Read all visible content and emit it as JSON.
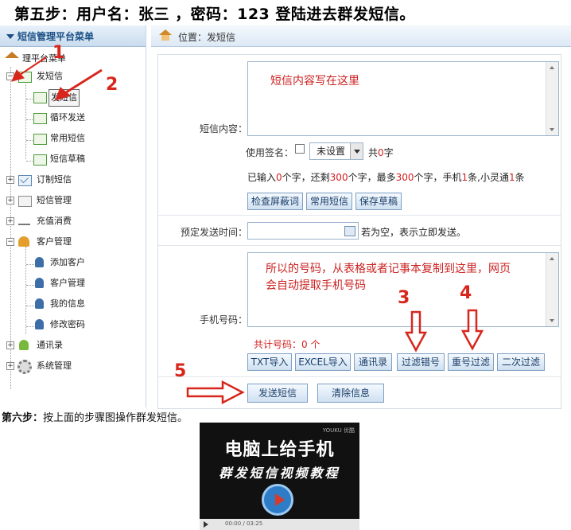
{
  "heading": "第五步：用户名：张三 ，密码：123 登陆进去群发短信。",
  "sidebar": {
    "title": "短信管理平台菜单",
    "items": [
      {
        "label": "理平台菜单",
        "icon": "home-icon"
      },
      {
        "label": "发短信",
        "icon": "mail-icon"
      },
      {
        "label": "发短信",
        "icon": "mail-send-icon"
      },
      {
        "label": "循环发送",
        "icon": "mail-send-icon"
      },
      {
        "label": "常用短信",
        "icon": "mail-send-icon"
      },
      {
        "label": "短信草稿",
        "icon": "mail-send-icon"
      },
      {
        "label": "订制短信",
        "icon": "mail-icon"
      },
      {
        "label": "短信管理",
        "icon": "calendar-icon"
      },
      {
        "label": "充值消费",
        "icon": "cart-icon"
      },
      {
        "label": "客户管理",
        "icon": "group-icon"
      },
      {
        "label": "添加客户",
        "icon": "user-icon"
      },
      {
        "label": "客户管理",
        "icon": "user-icon"
      },
      {
        "label": "我的信息",
        "icon": "user-icon"
      },
      {
        "label": "修改密码",
        "icon": "user-icon"
      },
      {
        "label": "通讯录",
        "icon": "contact-icon"
      },
      {
        "label": "系统管理",
        "icon": "gear-icon"
      }
    ]
  },
  "breadcrumb": "位置：发短信",
  "form": {
    "content_label": "短信内容：",
    "content_value": "短信内容写在这里",
    "signature_label": "使用签名：",
    "signature_select": "未设置",
    "signature_count_prefix": "共",
    "signature_count": "0",
    "signature_count_suffix": "字",
    "counter": {
      "p1": "已输入",
      "v1": "0",
      "p2": "个字，还剩",
      "v2": "300",
      "p3": "个字，最多",
      "v3": "300",
      "p4": "个字，手机",
      "v4": "1",
      "p5": "条,小灵通",
      "v5": "1",
      "p6": "条"
    },
    "buttons_row1": [
      "检查屏蔽词",
      "常用短信",
      "保存草稿"
    ],
    "schedule_label": "预定发送时间：",
    "schedule_hint": "若为空，表示立即发送。",
    "phone_label": "手机号码：",
    "phone_value_line1": "所以的号码，从表格或者记事本复制到这里，网页",
    "phone_value_line2": "会自动提取手机号码",
    "phone_count_prefix": "共计号码：",
    "phone_count": "0",
    "phone_count_suffix": " 个",
    "buttons_row2": [
      "TXT导入",
      "EXCEL导入",
      "通讯录",
      "过滤错号",
      "重号过滤",
      "二次过滤"
    ],
    "send_button": "发送短信",
    "clear_button": "清除信息"
  },
  "annotations": {
    "n1": "1",
    "n2": "2",
    "n3": "3",
    "n4": "4",
    "n5": "5",
    "color": "#d8261c"
  },
  "step6": {
    "bold": "第六步：",
    "text": "按上面的步骤图操作群发短信。"
  },
  "video": {
    "line1": "电脑上给手机",
    "line2": "群发短信视频教程",
    "brand": "YOUKU 优酷",
    "time": "00:00 / 03:25"
  }
}
